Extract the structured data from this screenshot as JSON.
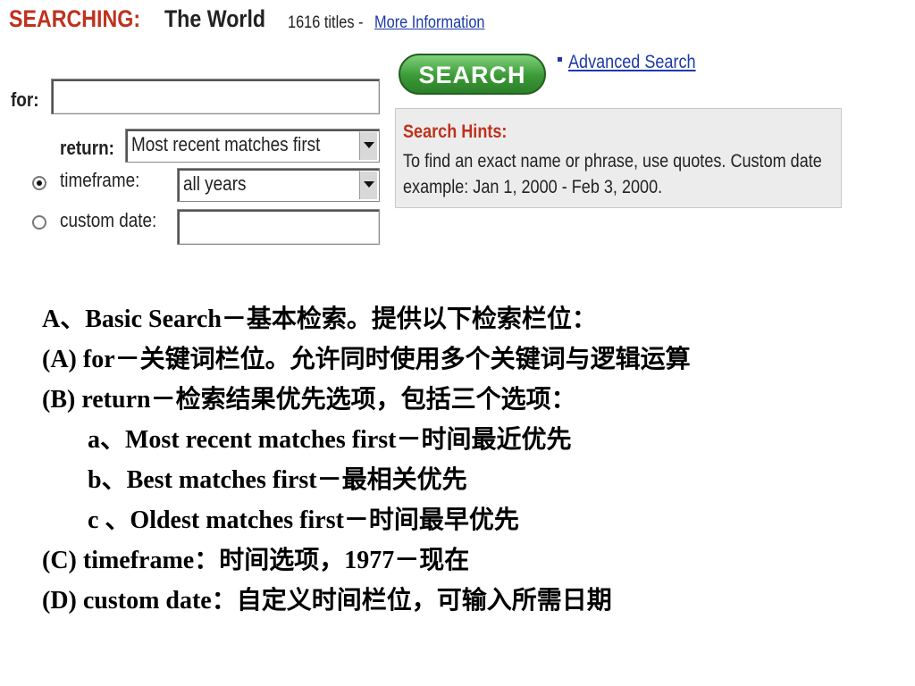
{
  "header": {
    "searching_label": "SEARCHING:",
    "database_name": "The World",
    "title_count": "1616 titles -",
    "more_info_link": "More Information"
  },
  "form": {
    "for_label": "for:",
    "for_value": "",
    "return_label": "return:",
    "return_selected": "Most recent matches first",
    "timeframe_label": "timeframe:",
    "timeframe_selected": "all years",
    "timeframe_checked": true,
    "custom_date_label": "custom date:",
    "custom_date_value": "",
    "custom_date_checked": false,
    "search_button": "SEARCH",
    "advanced_search_link": "Advanced Search"
  },
  "hints": {
    "title": "Search Hints:",
    "body": "To find an exact name or phrase, use quotes. Custom date example: Jan 1, 2000 - Feb 3, 2000."
  },
  "notes": {
    "lines": [
      "A、Basic Search－基本检索。提供以下检索栏位：",
      "(A) for－关键词栏位。允许同时使用多个关键词与逻辑运算",
      "(B) return－检索结果优先选项，包括三个选项：",
      "a、Most recent matches first－时间最近优先",
      "b、Best matches first－最相关优先",
      "c 、Oldest matches first－时间最早优先",
      "(C) timeframe：时间选项，1977－现在",
      "(D) custom date：自定义时间栏位，可输入所需日期"
    ]
  },
  "colors": {
    "brand_red": "#c0311d",
    "link_blue": "#1b3aa8",
    "search_green": "#3a9a36",
    "hints_bg": "#ececec"
  }
}
